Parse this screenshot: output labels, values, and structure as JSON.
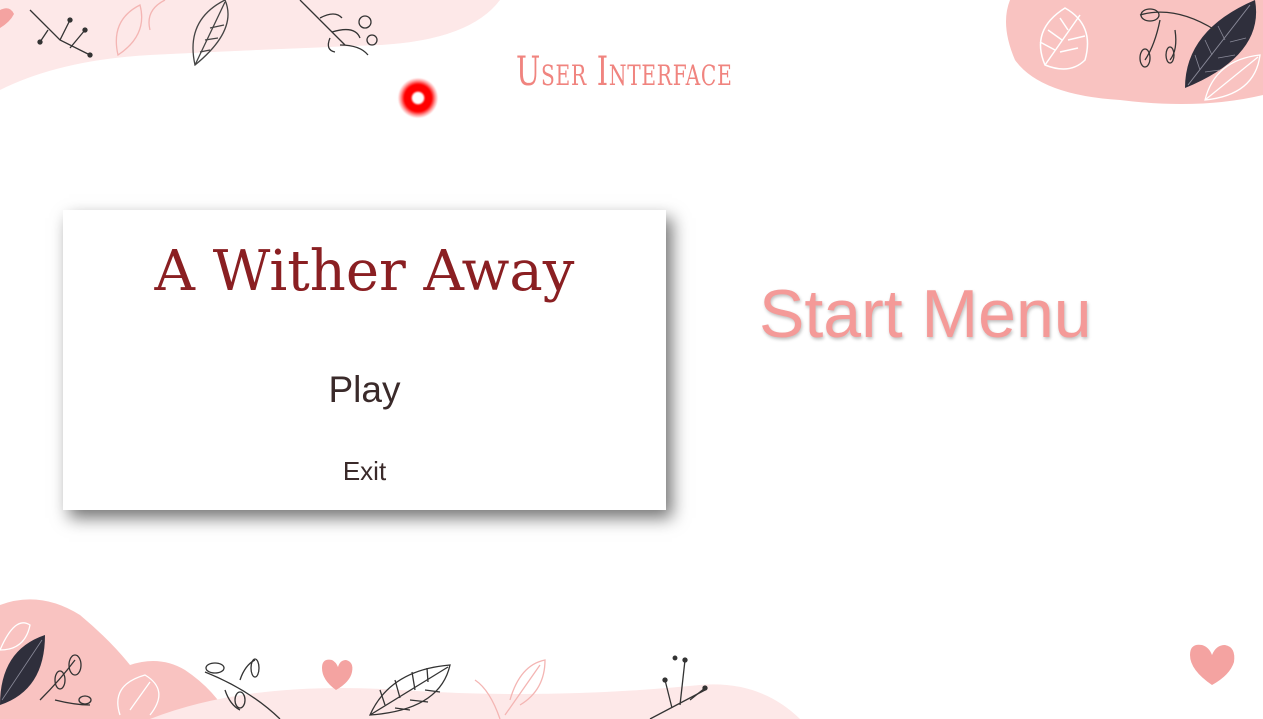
{
  "slide": {
    "header_title": "User Interface",
    "section_label": "Start Menu"
  },
  "menu": {
    "game_title": "A Wither Away",
    "play_label": "Play",
    "exit_label": "Exit"
  },
  "colors": {
    "accent_pink": "#f0847f",
    "blob_pink": "#f9c3c1",
    "title_red": "#8a1f22",
    "label_pink": "#f49a98",
    "leaf_dark": "#2f2f3c",
    "laser_red": "#ff0000"
  },
  "icons": [
    "leaf-icon",
    "branch-icon",
    "heart-icon",
    "laser-pointer-icon"
  ]
}
